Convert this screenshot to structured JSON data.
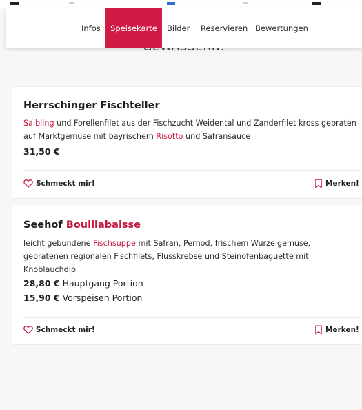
{
  "colors": {
    "accent": "#d11a45",
    "highlight_text": "#c8173f",
    "background": "#f7f7f7"
  },
  "nav": {
    "items": [
      {
        "label": "Infos"
      },
      {
        "label": "Speisekarte",
        "active": true
      },
      {
        "label": "Bilder"
      },
      {
        "label": "Reservieren"
      },
      {
        "label": "Bewertungen"
      }
    ]
  },
  "section": {
    "heading": "GEWÄSSERN."
  },
  "dishes": [
    {
      "title": "Herrschinger Fischteller",
      "description_parts": {
        "hl1": "Saibling",
        "t1": " und Forellenfilet aus der Fischzucht Weidental und Zanderfilet kross gebraten auf Marktgemüse mit bayrischem ",
        "hl2": "Risotto",
        "t2": " und Safransauce"
      },
      "prices": [
        {
          "price": "31,50 €",
          "label": ""
        }
      ],
      "like_label": "Schmeckt mir!",
      "bookmark_label": "Merken!"
    },
    {
      "title_parts": {
        "t1": "Seehof ",
        "hl1": "Bouillabaisse"
      },
      "description_parts": {
        "t1": "leicht gebundene ",
        "hl1": "Fischsuppe",
        "t2": " mit Safran, Pernod, frischem Wurzelgemüse, gebratenen regionalen Fischfilets, Flusskrebse und Steinofenbaguette mit Knoblauchdip"
      },
      "prices": [
        {
          "price": "28,80 €",
          "label": " Hauptgang Portion"
        },
        {
          "price": "15,90 €",
          "label": " Vorspeisen Portion"
        }
      ],
      "like_label": "Schmeckt mir!",
      "bookmark_label": "Merken!"
    }
  ],
  "icons": {
    "like": "heart-outline-icon",
    "bookmark": "bookmark-outline-icon"
  }
}
